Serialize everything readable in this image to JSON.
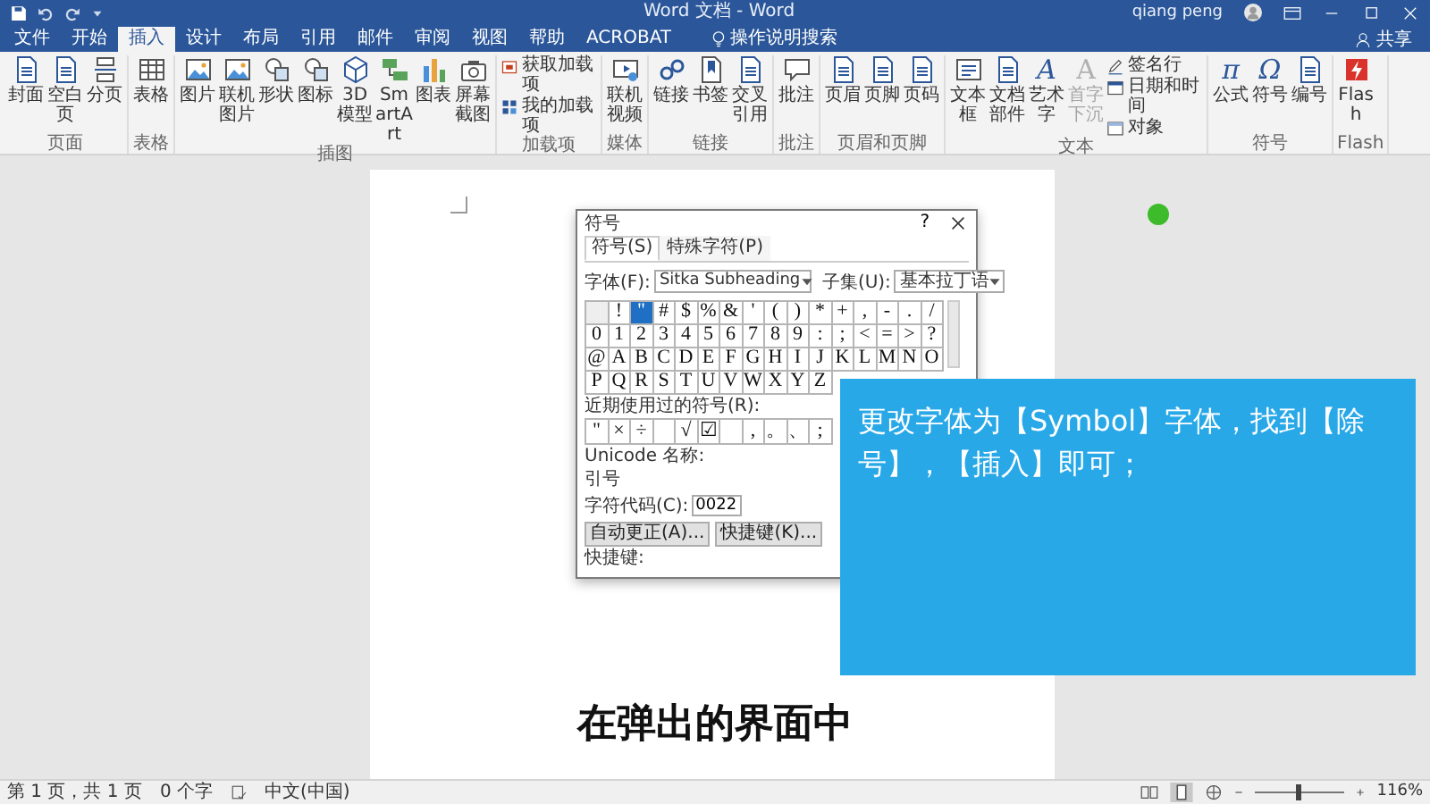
{
  "title_bar": {
    "title": "Word 文档 - Word",
    "user": "qiang peng"
  },
  "tabs": [
    {
      "label": "文件",
      "selected": false
    },
    {
      "label": "开始",
      "selected": false
    },
    {
      "label": "插入",
      "selected": true
    },
    {
      "label": "设计",
      "selected": false
    },
    {
      "label": "布局",
      "selected": false
    },
    {
      "label": "引用",
      "selected": false
    },
    {
      "label": "邮件",
      "selected": false
    },
    {
      "label": "审阅",
      "selected": false
    },
    {
      "label": "视图",
      "selected": false
    },
    {
      "label": "帮助",
      "selected": false
    },
    {
      "label": "ACROBAT",
      "selected": false
    }
  ],
  "tell_me": "操作说明搜索",
  "share": "共享",
  "ribbon_groups": [
    {
      "label": "页面",
      "items": [
        {
          "kind": "large",
          "label": "封面",
          "disabled": false
        },
        {
          "kind": "large",
          "label": "空白页",
          "disabled": false
        },
        {
          "kind": "large",
          "label": "分页",
          "disabled": false
        }
      ]
    },
    {
      "label": "表格",
      "items": [
        {
          "kind": "large",
          "label": "表格",
          "disabled": false
        }
      ]
    },
    {
      "label": "插图",
      "items": [
        {
          "kind": "large",
          "label": "图片",
          "disabled": false
        },
        {
          "kind": "large",
          "label": "联机图片",
          "disabled": false
        },
        {
          "kind": "large",
          "label": "形状",
          "disabled": false
        },
        {
          "kind": "large",
          "label": "图标",
          "disabled": false
        },
        {
          "kind": "large",
          "label": "3D 模型",
          "disabled": false
        },
        {
          "kind": "large",
          "label": "SmartArt",
          "disabled": false
        },
        {
          "kind": "large",
          "label": "图表",
          "disabled": false
        },
        {
          "kind": "large",
          "label": "屏幕截图",
          "disabled": false
        }
      ]
    },
    {
      "label": "加载项",
      "items": [
        {
          "kind": "small",
          "label": "获取加载项",
          "disabled": false
        },
        {
          "kind": "small",
          "label": "我的加载项",
          "disabled": false
        }
      ]
    },
    {
      "label": "媒体",
      "items": [
        {
          "kind": "large",
          "label": "联机视频",
          "disabled": false
        }
      ]
    },
    {
      "label": "链接",
      "items": [
        {
          "kind": "large",
          "label": "链接",
          "disabled": false
        },
        {
          "kind": "large",
          "label": "书签",
          "disabled": false
        },
        {
          "kind": "large",
          "label": "交叉引用",
          "disabled": false
        }
      ]
    },
    {
      "label": "批注",
      "items": [
        {
          "kind": "large",
          "label": "批注",
          "disabled": false
        }
      ]
    },
    {
      "label": "页眉和页脚",
      "items": [
        {
          "kind": "large",
          "label": "页眉",
          "disabled": false
        },
        {
          "kind": "large",
          "label": "页脚",
          "disabled": false
        },
        {
          "kind": "large",
          "label": "页码",
          "disabled": false
        }
      ]
    },
    {
      "label": "文本",
      "items": [
        {
          "kind": "large",
          "label": "文本框",
          "disabled": false
        },
        {
          "kind": "large",
          "label": "文档部件",
          "disabled": false
        },
        {
          "kind": "large",
          "label": "艺术字",
          "glyph": "A",
          "disabled": false
        },
        {
          "kind": "large",
          "label": "首字下沉",
          "glyph": "A",
          "disabled": true
        },
        {
          "kind": "small",
          "label": "签名行",
          "disabled": false
        },
        {
          "kind": "small",
          "label": "日期和时间",
          "disabled": false
        },
        {
          "kind": "small",
          "label": "对象",
          "disabled": false
        }
      ]
    },
    {
      "label": "符号",
      "items": [
        {
          "kind": "large",
          "label": "公式",
          "glyph": "π",
          "disabled": false
        },
        {
          "kind": "large",
          "label": "符号",
          "glyph": "Ω",
          "disabled": false
        },
        {
          "kind": "large",
          "label": "编号",
          "disabled": false
        }
      ]
    },
    {
      "label": "Flash",
      "items": [
        {
          "kind": "large",
          "label": "Flash",
          "disabled": false
        }
      ]
    }
  ],
  "symbol_dialog": {
    "title": "符号",
    "help": "?",
    "tabs": [
      {
        "label": "符号(S)",
        "selected": true
      },
      {
        "label": "特殊字符(P)",
        "selected": false
      }
    ],
    "font_label": "字体(F):",
    "font": "Sitka Subheading",
    "subset_label": "子集(U):",
    "subset": "基本拉丁语",
    "symbols": [
      [
        {
          "kind": "blank",
          "selected": false
        },
        {
          "char": "!",
          "selected": false
        },
        {
          "char": "\"",
          "selected": true
        },
        {
          "char": "#",
          "selected": false
        },
        {
          "char": "$",
          "selected": false
        },
        {
          "char": "%",
          "selected": false
        },
        {
          "char": "&",
          "selected": false
        },
        {
          "char": "'",
          "selected": false
        },
        {
          "char": "(",
          "selected": false
        },
        {
          "char": ")",
          "selected": false
        },
        {
          "char": "*",
          "selected": false
        },
        {
          "char": "+",
          "selected": false
        },
        {
          "char": ",",
          "selected": false
        },
        {
          "char": "-",
          "selected": false
        },
        {
          "char": ".",
          "selected": false
        },
        {
          "char": "/",
          "selected": false
        }
      ],
      [
        {
          "char": "0",
          "selected": false
        },
        {
          "char": "1",
          "selected": false
        },
        {
          "char": "2",
          "selected": false
        },
        {
          "char": "3",
          "selected": false
        },
        {
          "char": "4",
          "selected": false
        },
        {
          "char": "5",
          "selected": false
        },
        {
          "char": "6",
          "selected": false
        },
        {
          "char": "7",
          "selected": false
        },
        {
          "char": "8",
          "selected": false
        },
        {
          "char": "9",
          "selected": false
        },
        {
          "char": ":",
          "selected": false
        },
        {
          "char": ";",
          "selected": false
        },
        {
          "char": "<",
          "selected": false
        },
        {
          "char": "=",
          "selected": false
        },
        {
          "char": ">",
          "selected": false
        },
        {
          "char": "?",
          "selected": false
        }
      ],
      [
        {
          "char": "@",
          "selected": false
        },
        {
          "char": "A",
          "selected": false
        },
        {
          "char": "B",
          "selected": false
        },
        {
          "char": "C",
          "selected": false
        },
        {
          "char": "D",
          "selected": false
        },
        {
          "char": "E",
          "selected": false
        },
        {
          "char": "F",
          "selected": false
        },
        {
          "char": "G",
          "selected": false
        },
        {
          "char": "H",
          "selected": false
        },
        {
          "char": "I",
          "selected": false
        },
        {
          "char": "J",
          "selected": false
        },
        {
          "char": "K",
          "selected": false
        },
        {
          "char": "L",
          "selected": false
        },
        {
          "char": "M",
          "selected": false
        },
        {
          "char": "N",
          "selected": false
        },
        {
          "char": "O",
          "selected": false
        }
      ],
      [
        {
          "char": "P",
          "selected": false
        },
        {
          "char": "Q",
          "selected": false
        },
        {
          "char": "R",
          "selected": false
        },
        {
          "char": "S",
          "selected": false
        },
        {
          "char": "T",
          "selected": false
        },
        {
          "char": "U",
          "selected": false
        },
        {
          "char": "V",
          "selected": false
        },
        {
          "char": "W",
          "selected": false
        },
        {
          "char": "X",
          "selected": false
        },
        {
          "char": "Y",
          "selected": false
        },
        {
          "char": "Z",
          "selected": false
        }
      ]
    ],
    "recent_label": "近期使用过的符号(R):",
    "recent": [
      {
        "kind": "char",
        "char": "\""
      },
      {
        "kind": "char",
        "char": "×"
      },
      {
        "kind": "char",
        "char": "÷"
      },
      {
        "kind": "blank"
      },
      {
        "kind": "char",
        "char": "√"
      },
      {
        "kind": "char",
        "char": "☑"
      },
      {
        "kind": "blank"
      },
      {
        "kind": "char",
        "char": ","
      },
      {
        "kind": "char",
        "char": "。"
      },
      {
        "kind": "char",
        "char": "、"
      },
      {
        "kind": "char",
        "char": ";"
      }
    ],
    "unicode_name_label": "Unicode 名称:",
    "unicode_name": "引号",
    "char_code_label": "字符代码(C):",
    "char_code": "0022",
    "buttons": [
      "自动更正(A)...",
      "快捷键(K)..."
    ],
    "shortcut_label": "快捷键:"
  },
  "instruction": "更改字体为【Symbol】字体，找到【除号】，【插入】即可；",
  "subtitle": "在弹出的界面中",
  "status_bar": {
    "page": "第 1 页，共 1 页",
    "words": "0 个字",
    "language": "中文(中国)",
    "zoom": {
      "level": 0.48,
      "reading": "116%"
    }
  }
}
